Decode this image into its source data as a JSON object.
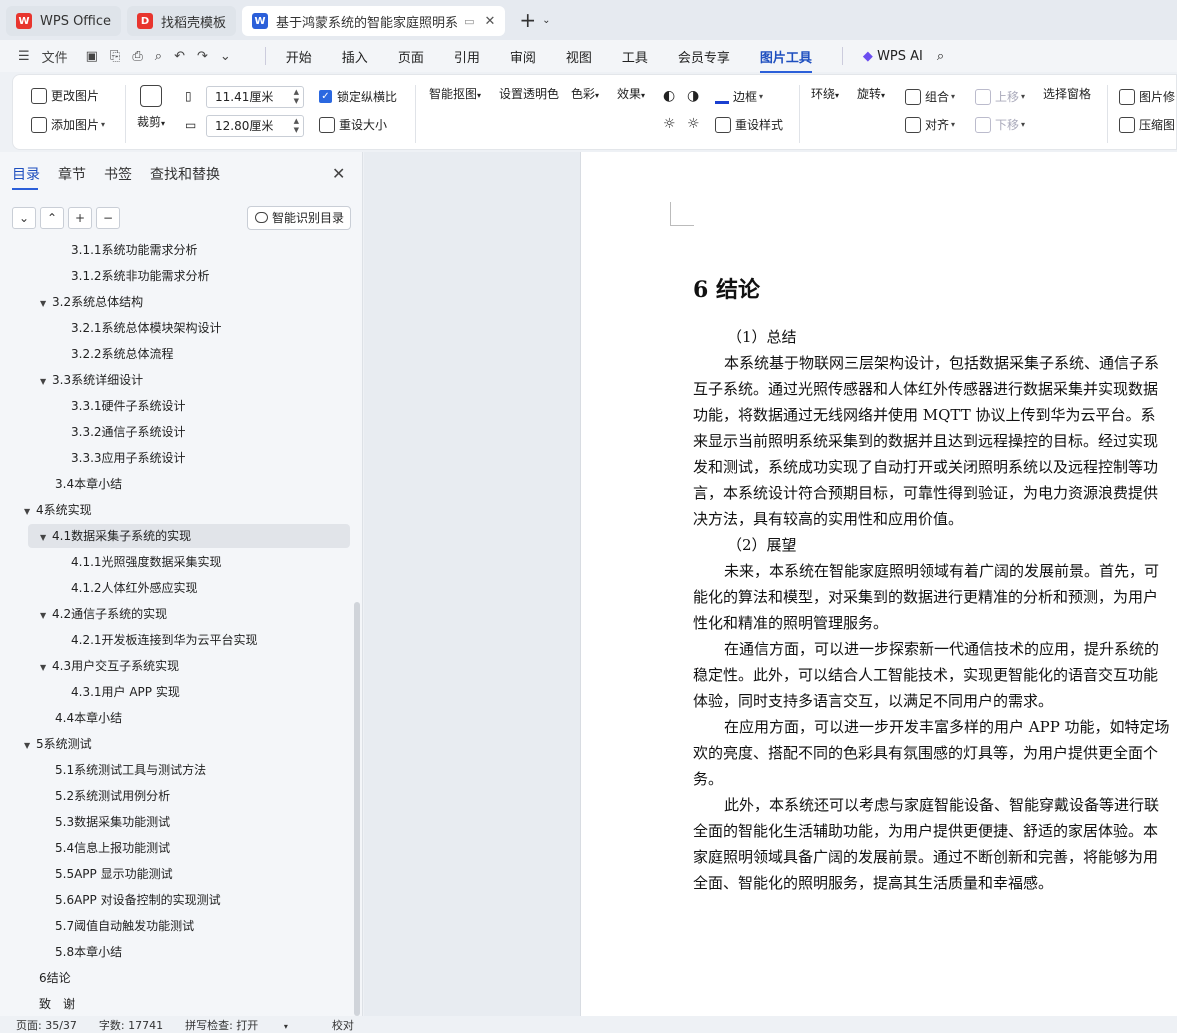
{
  "tabs": [
    {
      "label": "WPS Office",
      "logo": "W",
      "color": "#e8352e"
    },
    {
      "label": "找稻壳模板",
      "logo": "D",
      "color": "#e8352e"
    },
    {
      "label": "基于鸿蒙系统的智能家庭照明系",
      "logo": "W",
      "color": "#2b5fd9"
    }
  ],
  "menu": {
    "file": "文件",
    "items": [
      "开始",
      "插入",
      "页面",
      "引用",
      "审阅",
      "视图",
      "工具",
      "会员专享",
      "图片工具"
    ],
    "ai": "WPS AI"
  },
  "ribbon": {
    "change_pic": "更改图片",
    "add_pic": "添加图片",
    "crop": "裁剪",
    "width": "11.41厘米",
    "height": "12.80厘米",
    "lock_ratio": "锁定纵横比",
    "reset_size": "重设大小",
    "smart_cutout": "智能抠图",
    "transparent": "设置透明色",
    "color": "色彩",
    "effect": "效果",
    "border": "边框",
    "reset_style": "重设样式",
    "wrap": "环绕",
    "rotate": "旋转",
    "group": "组合",
    "align": "对齐",
    "up": "上移",
    "down": "下移",
    "select_pane": "选择窗格",
    "pic_edit": "图片修",
    "compress": "压缩图"
  },
  "nav": {
    "tabs": [
      "目录",
      "章节",
      "书签",
      "查找和替换"
    ],
    "smart_toc": "智能识别目录",
    "items": [
      {
        "text": "3.1.1系统功能需求分析",
        "level": 3,
        "caret": false
      },
      {
        "text": "3.1.2系统非功能需求分析",
        "level": 3,
        "caret": false
      },
      {
        "text": "3.2系统总体结构",
        "level": 2,
        "caret": true
      },
      {
        "text": "3.2.1系统总体模块架构设计",
        "level": 3,
        "caret": false
      },
      {
        "text": "3.2.2系统总体流程",
        "level": 3,
        "caret": false
      },
      {
        "text": "3.3系统详细设计",
        "level": 2,
        "caret": true
      },
      {
        "text": "3.3.1硬件子系统设计",
        "level": 3,
        "caret": false
      },
      {
        "text": "3.3.2通信子系统设计",
        "level": 3,
        "caret": false
      },
      {
        "text": "3.3.3应用子系统设计",
        "level": 3,
        "caret": false
      },
      {
        "text": "3.4本章小结",
        "level": 2,
        "caret": false
      },
      {
        "text": "4系统实现",
        "level": 1,
        "caret": true
      },
      {
        "text": "4.1数据采集子系统的实现",
        "level": 2,
        "caret": true,
        "selected": true
      },
      {
        "text": "4.1.1光照强度数据采集实现",
        "level": 3,
        "caret": false
      },
      {
        "text": "4.1.2人体红外感应实现",
        "level": 3,
        "caret": false
      },
      {
        "text": "4.2通信子系统的实现",
        "level": 2,
        "caret": true
      },
      {
        "text": "4.2.1开发板连接到华为云平台实现",
        "level": 3,
        "caret": false
      },
      {
        "text": "4.3用户交互子系统实现",
        "level": 2,
        "caret": true
      },
      {
        "text": "4.3.1用户 APP 实现",
        "level": 3,
        "caret": false
      },
      {
        "text": "4.4本章小结",
        "level": 2,
        "caret": false
      },
      {
        "text": "5系统测试",
        "level": 1,
        "caret": true
      },
      {
        "text": "5.1系统测试工具与测试方法",
        "level": 2,
        "caret": false
      },
      {
        "text": "5.2系统测试用例分析",
        "level": 2,
        "caret": false
      },
      {
        "text": "5.3数据采集功能测试",
        "level": 2,
        "caret": false
      },
      {
        "text": "5.4信息上报功能测试",
        "level": 2,
        "caret": false
      },
      {
        "text": "5.5APP 显示功能测试",
        "level": 2,
        "caret": false
      },
      {
        "text": "5.6APP 对设备控制的实现测试",
        "level": 2,
        "caret": false
      },
      {
        "text": "5.7阈值自动触发功能测试",
        "level": 2,
        "caret": false
      },
      {
        "text": "5.8本章小结",
        "level": 2,
        "caret": false
      },
      {
        "text": "6结论",
        "level": 1,
        "caret": false
      },
      {
        "text": "致　谢",
        "level": 1,
        "caret": false
      }
    ]
  },
  "document": {
    "heading": "6  结论",
    "lines": [
      {
        "t": "（1）总结",
        "cls": "sub"
      },
      {
        "t": "本系统基于物联网三层架构设计，包括数据采集子系统、通信子系",
        "cls": "indent"
      },
      {
        "t": "互子系统。通过光照传感器和人体红外传感器进行数据采集并实现数据",
        "cls": ""
      },
      {
        "t": "功能，将数据通过无线网络并使用 MQTT 协议上传到华为云平台。系",
        "cls": ""
      },
      {
        "t": "来显示当前照明系统采集到的数据并且达到远程操控的目标。经过实现",
        "cls": ""
      },
      {
        "t": "发和测试，系统成功实现了自动打开或关闭照明系统以及远程控制等功",
        "cls": ""
      },
      {
        "t": "言，本系统设计符合预期目标，可靠性得到验证，为电力资源浪费提供",
        "cls": ""
      },
      {
        "t": "决方法，具有较高的实用性和应用价值。",
        "cls": ""
      },
      {
        "t": "（2）展望",
        "cls": "sub"
      },
      {
        "t": "未来，本系统在智能家庭照明领域有着广阔的发展前景。首先，可",
        "cls": "indent"
      },
      {
        "t": "能化的算法和模型，对采集到的数据进行更精准的分析和预测，为用户",
        "cls": ""
      },
      {
        "t": "性化和精准的照明管理服务。",
        "cls": ""
      },
      {
        "t": "在通信方面，可以进一步探索新一代通信技术的应用，提升系统的",
        "cls": "indent"
      },
      {
        "t": "稳定性。此外，可以结合人工智能技术，实现更智能化的语音交互功能",
        "cls": ""
      },
      {
        "t": "体验，同时支持多语言交互，以满足不同用户的需求。",
        "cls": ""
      },
      {
        "t": "在应用方面，可以进一步开发丰富多样的用户 APP 功能，如特定场",
        "cls": "indent"
      },
      {
        "t": "欢的亮度、搭配不同的色彩具有氛围感的灯具等，为用户提供更全面个",
        "cls": ""
      },
      {
        "t": "务。",
        "cls": ""
      },
      {
        "t": "此外，本系统还可以考虑与家庭智能设备、智能穿戴设备等进行联",
        "cls": "indent"
      },
      {
        "t": "全面的智能化生活辅助功能，为用户提供更便捷、舒适的家居体验。本",
        "cls": ""
      },
      {
        "t": "家庭照明领域具备广阔的发展前景。通过不断创新和完善，将能够为用",
        "cls": ""
      },
      {
        "t": "全面、智能化的照明服务，提高其生活质量和幸福感。",
        "cls": ""
      }
    ]
  },
  "status": {
    "page": "页面: 35/37",
    "words": "字数: 17741",
    "spell": "拼写检查: 打开",
    "proof": "校对"
  }
}
